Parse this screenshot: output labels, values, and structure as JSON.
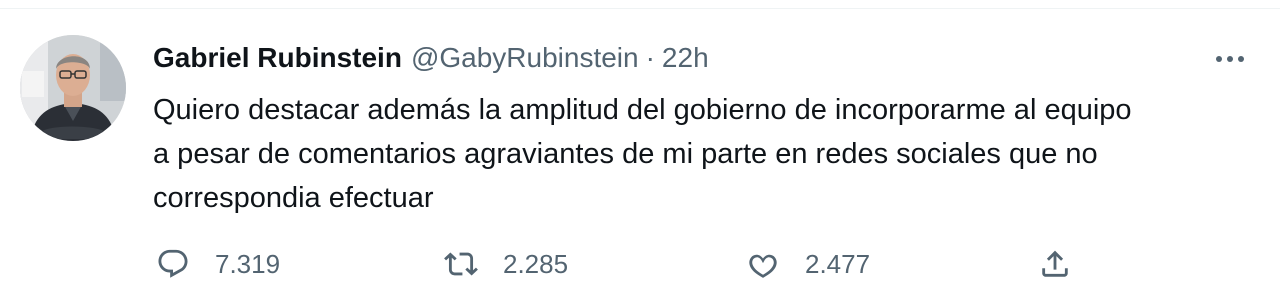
{
  "tweet": {
    "author": {
      "display_name": "Gabriel Rubinstein",
      "handle": "@GabyRubinstein",
      "avatar": "person-photo-avatar"
    },
    "separator": "·",
    "time": "22h",
    "text_lines": [
      "Quiero destacar además la amplitud del gobierno de incorporarme al equipo",
      "a pesar de comentarios agraviantes de mi parte en redes sociales que no",
      "correspondia efectuar"
    ],
    "actions": {
      "reply": {
        "icon": "reply-icon",
        "count": "7.319"
      },
      "retweet": {
        "icon": "retweet-icon",
        "count": "2.285"
      },
      "like": {
        "icon": "heart-icon",
        "count": "2.477"
      },
      "share": {
        "icon": "share-icon"
      }
    },
    "more_icon": "more-options-icon"
  },
  "colors": {
    "text_primary": "#0f1419",
    "text_secondary": "#536471",
    "border": "#eff3f4"
  }
}
